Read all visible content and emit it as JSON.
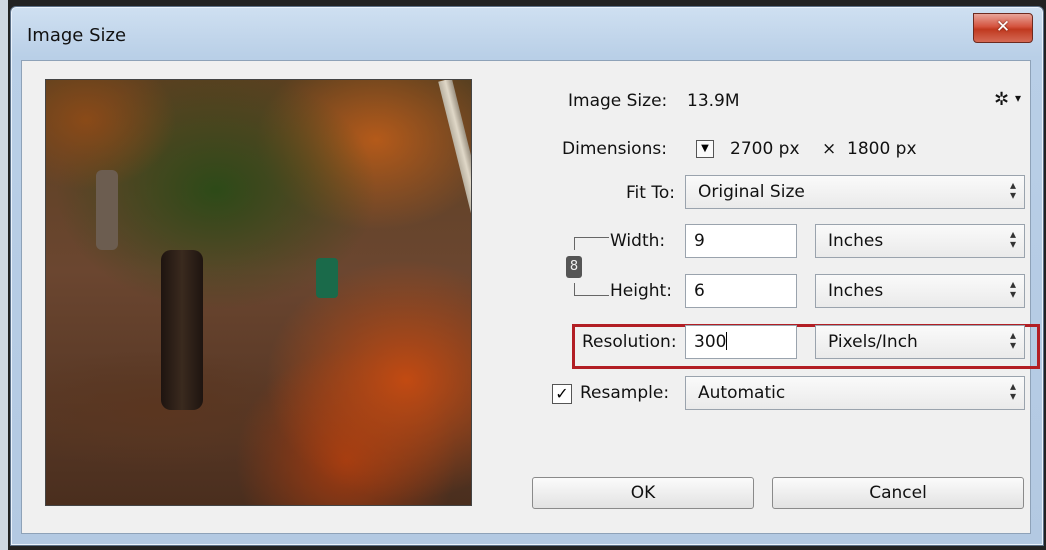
{
  "window": {
    "title": "Image Size",
    "close_symbol": "✕"
  },
  "info": {
    "image_size_label": "Image Size:",
    "image_size_value": "13.9M",
    "dimensions_label": "Dimensions:",
    "dimensions_width": "2700 px",
    "dimensions_times": "×",
    "dimensions_height": "1800 px",
    "gear_symbol": "✲"
  },
  "fit_to": {
    "label": "Fit To:",
    "value": "Original Size"
  },
  "width": {
    "label": "Width:",
    "value": "9",
    "unit": "Inches"
  },
  "height": {
    "label": "Height:",
    "value": "6",
    "unit": "Inches"
  },
  "resolution": {
    "label": "Resolution:",
    "value": "300",
    "unit": "Pixels/Inch"
  },
  "resample": {
    "label": "Resample:",
    "value": "Automatic",
    "checked": true
  },
  "buttons": {
    "ok": "OK",
    "cancel": "Cancel"
  },
  "colors": {
    "highlight": "#b21e24",
    "close": "#c0391f"
  },
  "icons": {
    "gear": "gear-icon",
    "link": "chain-link-icon",
    "dimensions_toggle": "chevron-down-icon"
  }
}
